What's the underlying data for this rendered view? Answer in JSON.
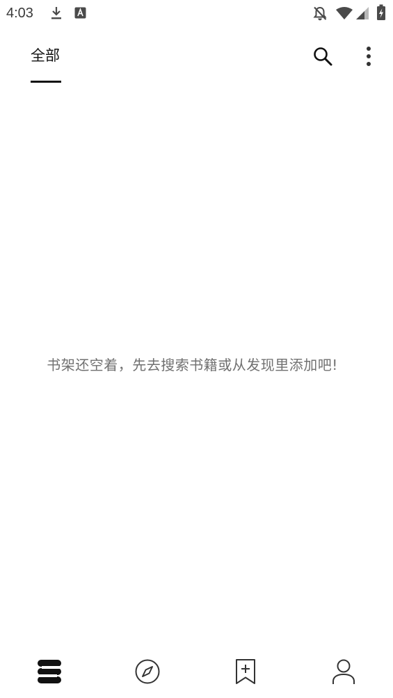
{
  "status_bar": {
    "time": "4:03",
    "icons": [
      "download-icon",
      "a-badge-icon",
      "notifications-off-icon",
      "wifi-icon",
      "signal-icon",
      "battery-charging-icon"
    ]
  },
  "app_bar": {
    "tab_label": "全部",
    "actions": [
      "search-icon",
      "more-vert-icon"
    ]
  },
  "main": {
    "empty_message": "书架还空着，先去搜索书籍或从发现里添加吧!"
  },
  "bottom_nav": {
    "items": [
      "bookshelf-icon",
      "explore-compass-icon",
      "bookmark-add-icon",
      "profile-icon"
    ],
    "active": "bookshelf-icon"
  },
  "colors": {
    "background": "#ffffff",
    "text_primary": "#111111",
    "text_secondary": "#707070",
    "status_icon": "#4a4a4a"
  }
}
